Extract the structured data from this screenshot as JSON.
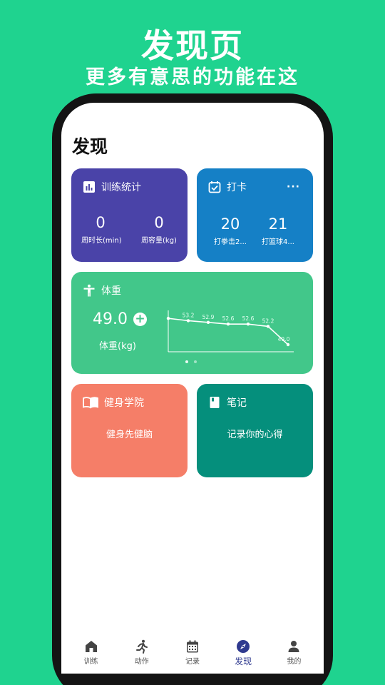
{
  "promo": {
    "title": "发现页",
    "subtitle": "更多有意思的功能在这"
  },
  "page": {
    "title": "发现"
  },
  "cards": {
    "stats": {
      "title": "训练统计",
      "items": [
        {
          "value": "0",
          "label": "周时长(min)"
        },
        {
          "value": "0",
          "label": "周容量(kg)"
        }
      ]
    },
    "checkin": {
      "title": "打卡",
      "more": "···",
      "items": [
        {
          "value": "20",
          "label": "打拳击2..."
        },
        {
          "value": "21",
          "label": "打篮球4..."
        }
      ]
    },
    "weight": {
      "title": "体重",
      "value": "49.0",
      "unit_label": "体重(kg)",
      "plus": "+",
      "chart_points": [
        "",
        "53.2",
        "52.9",
        "52.6",
        "52.6",
        "52.2",
        "49.0"
      ],
      "chart_values": [
        53.6,
        53.2,
        52.9,
        52.6,
        52.6,
        52.2,
        49.0
      ]
    },
    "academy": {
      "title": "健身学院",
      "text": "健身先健脑"
    },
    "notes": {
      "title": "笔记",
      "text": "记录你的心得"
    }
  },
  "tabs": [
    {
      "label": "训练",
      "icon": "home-icon"
    },
    {
      "label": "动作",
      "icon": "runner-icon"
    },
    {
      "label": "记录",
      "icon": "calendar-icon"
    },
    {
      "label": "发现",
      "icon": "compass-icon",
      "active": true
    },
    {
      "label": "我的",
      "icon": "person-icon"
    }
  ],
  "colors": {
    "background": "#1fd38f",
    "stats": "#4a43a8",
    "checkin": "#1580c6",
    "weight": "#42c78a",
    "academy": "#f57e68",
    "notes": "#058f7c",
    "active_tab": "#2f3a8f"
  }
}
